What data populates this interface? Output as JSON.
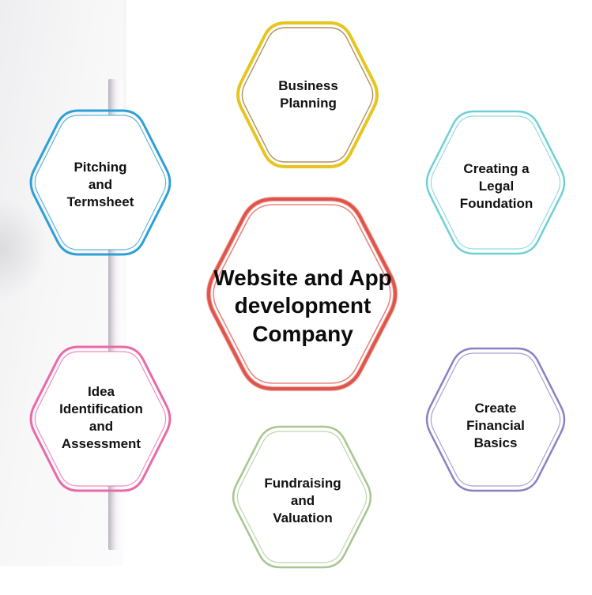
{
  "diagram": {
    "center": {
      "lines": [
        "Website and App",
        "development",
        "Company"
      ],
      "color": "#e0534a"
    },
    "nodes": [
      {
        "id": "business-planning",
        "lines": [
          "Business",
          "Planning"
        ],
        "color": "#e5c51e",
        "accent": "#9a6b2a"
      },
      {
        "id": "creating-legal-foundation",
        "lines": [
          "Creating a",
          "Legal",
          "Foundation"
        ],
        "color": "#6fcfd6",
        "accent": "#6fcfd6"
      },
      {
        "id": "create-financial-basics",
        "lines": [
          "Create",
          "Financial",
          "Basics"
        ],
        "color": "#8a80c4",
        "accent": "#8a80c4"
      },
      {
        "id": "fundraising-and-valuation",
        "lines": [
          "Fundraising",
          "and",
          "Valuation"
        ],
        "color": "#a8c690",
        "accent": "#a8c690"
      },
      {
        "id": "idea-identification-and-assessment",
        "lines": [
          "Idea",
          "Identification",
          "and",
          "Assessment"
        ],
        "color": "#e86aa8",
        "accent": "#e86aa8"
      },
      {
        "id": "pitching-and-termsheet",
        "lines": [
          "Pitching",
          "and",
          "Termsheet"
        ],
        "color": "#2e9fd6",
        "accent": "#2e9fd6"
      }
    ]
  }
}
